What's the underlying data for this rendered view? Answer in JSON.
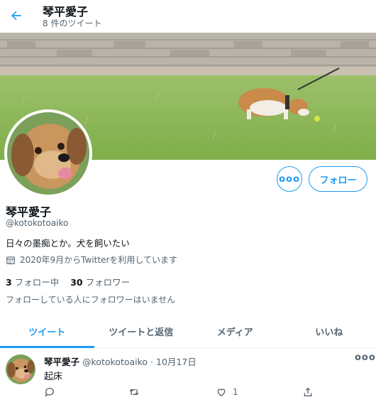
{
  "header": {
    "name": "琴平愛子",
    "tweet_count": "8 件のツイート"
  },
  "profile": {
    "name": "琴平愛子",
    "handle": "@kotokotoaiko",
    "bio": "日々の墨痴とか。犬を飼いたい",
    "joined": "2020年9月からTwitterを利用しています",
    "following_count": "3",
    "following_label": "フォロー中",
    "followers_count": "30",
    "followers_label": "フォロワー",
    "mutual_note": "フォローしている人にフォロワーはいません"
  },
  "buttons": {
    "more": "ooo",
    "follow": "フォロー"
  },
  "tabs": [
    {
      "label": "ツイート",
      "active": true
    },
    {
      "label": "ツイートと返信",
      "active": false
    },
    {
      "label": "メディア",
      "active": false
    },
    {
      "label": "いいね",
      "active": false
    }
  ],
  "tweet": {
    "name": "琴平愛子",
    "meta": "@kotokotoaiko · 10月17日",
    "text": "起床",
    "like_count": "1",
    "more": "ooo"
  },
  "colors": {
    "accent": "#1d9bf0",
    "secondary_text": "#536471"
  },
  "icons": {
    "back": "arrow-left-icon",
    "calendar": "calendar-icon",
    "reply": "reply-icon",
    "retweet": "retweet-icon",
    "like": "heart-icon",
    "share": "share-icon"
  }
}
